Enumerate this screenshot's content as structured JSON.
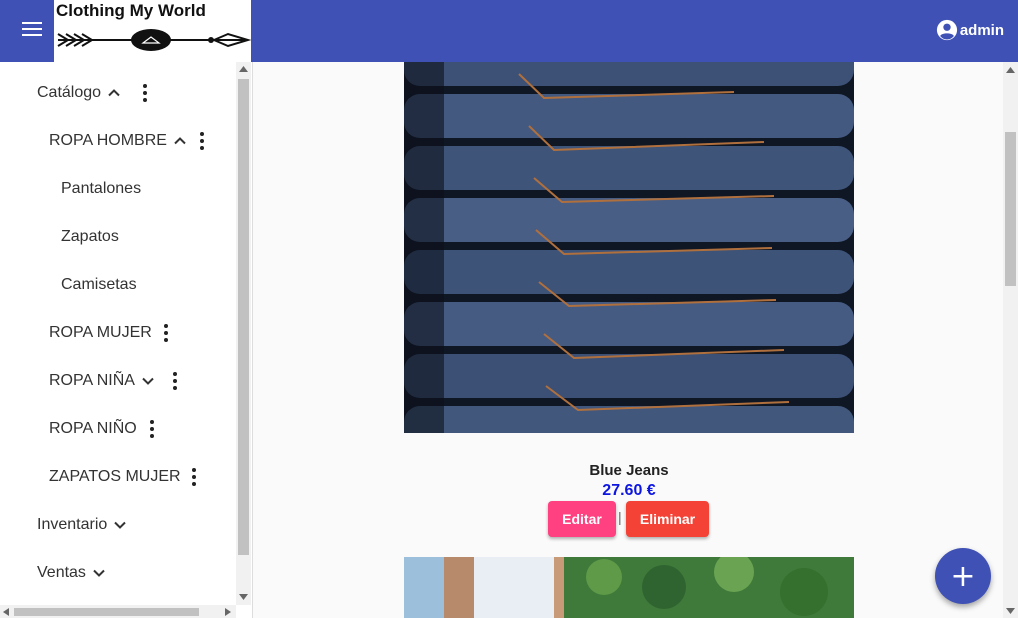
{
  "header": {
    "brand": "Clothing My World",
    "user_label": "admin",
    "bar_color": "#3f51b5"
  },
  "sidebar": {
    "catalog_label": "Catálogo",
    "hombre_label": "ROPA HOMBRE",
    "pantalones_label": "Pantalones",
    "zapatos_label": "Zapatos",
    "camisetas_label": "Camisetas",
    "mujer_label": "ROPA MUJER",
    "nina_label": "ROPA NIÑA",
    "nino_label": "ROPA NIÑO",
    "zapatos_mujer_label": "ZAPATOS MUJER",
    "inventario_label": "Inventario",
    "ventas_label": "Ventas"
  },
  "product": {
    "name": "Blue Jeans",
    "price": "27.60 €",
    "edit_label": "Editar",
    "separator": "|",
    "delete_label": "Eliminar"
  },
  "fab": {
    "label": "+"
  },
  "colors": {
    "accent": "#3f51b5",
    "edit": "#ff4081",
    "delete": "#f44336",
    "price": "#0d15e0"
  }
}
